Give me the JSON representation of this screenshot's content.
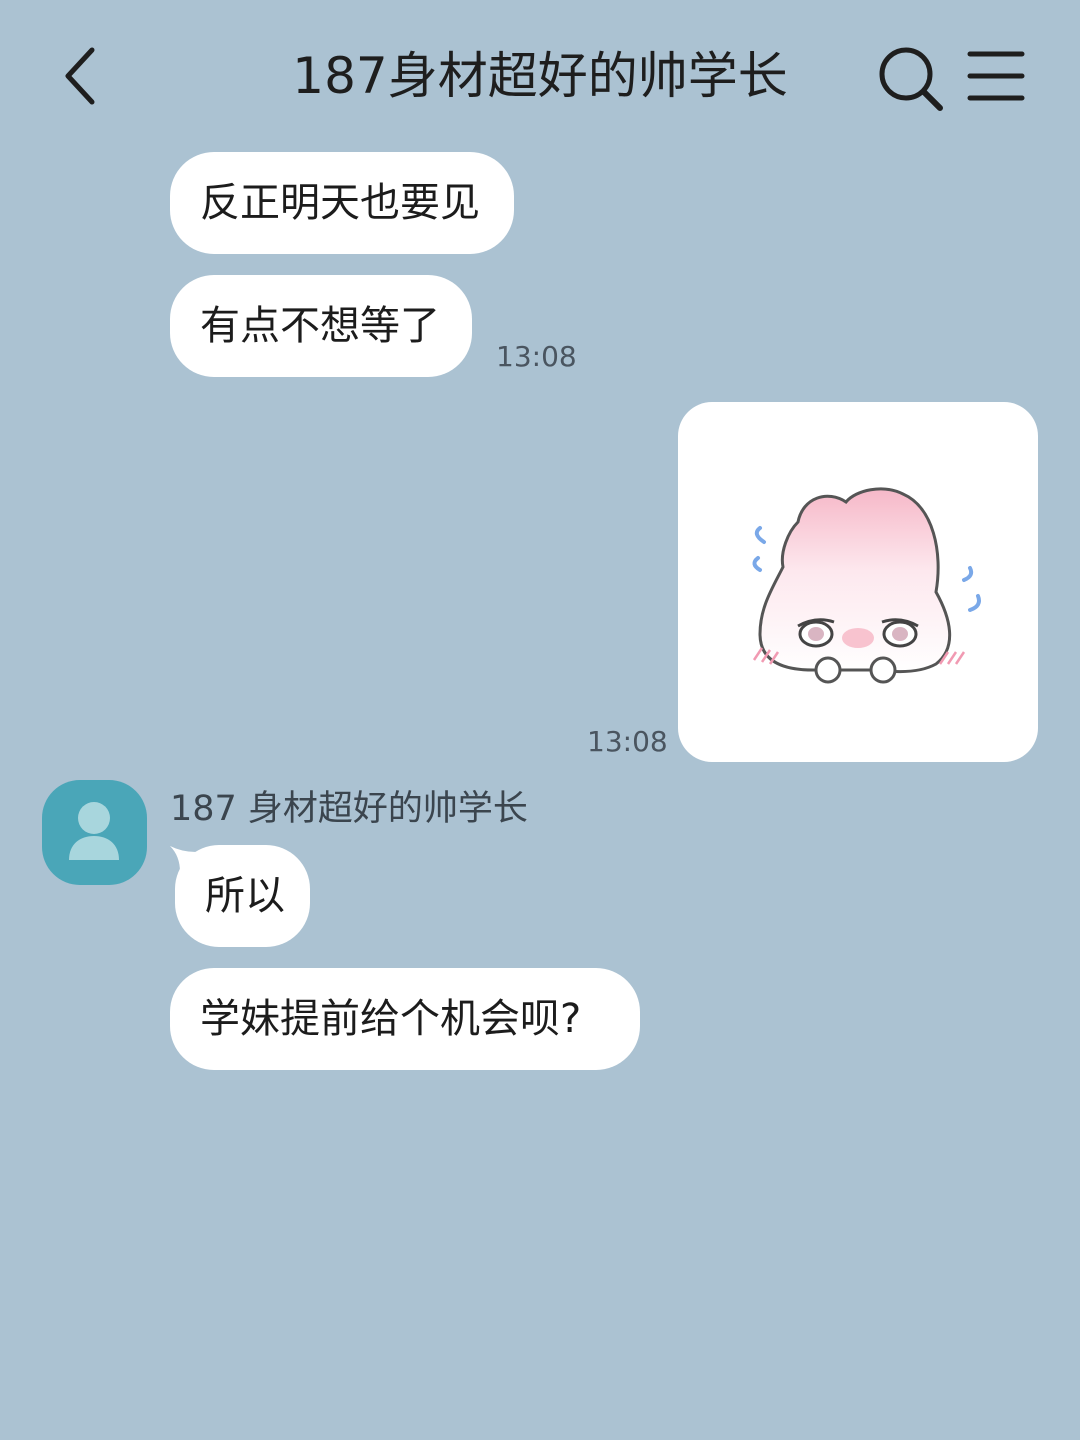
{
  "header": {
    "title": "187身材超好的帅学长",
    "back_icon": "chevron-left-icon",
    "search_icon": "search-icon",
    "menu_icon": "menu-icon"
  },
  "messages": {
    "m1": "反正明天也要见",
    "m2": "有点不想等了",
    "m2_time": "13:08",
    "sticker_time": "13:08",
    "sender": "187 身材超好的帅学长",
    "m3": "所以",
    "m4": "学妹提前给个机会呗?"
  },
  "colors": {
    "background": "#abc2d2",
    "bubble": "#ffffff",
    "avatar": "#4aa6b8"
  }
}
